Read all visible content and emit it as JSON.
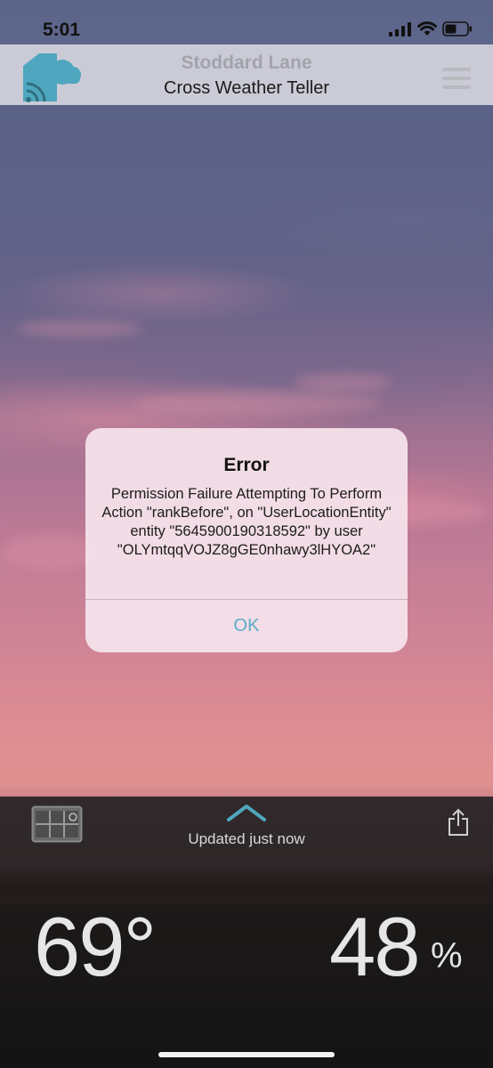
{
  "status_bar": {
    "time": "5:01"
  },
  "header": {
    "location": "Stoddard Lane",
    "app_name": "Cross Weather Teller",
    "logo_color": "#4fa6bf"
  },
  "dialog": {
    "title": "Error",
    "message": "Permission Failure Attempting To Perform Action \"rankBefore\", on \"UserLocationEntity\" entity \"5645900190318592\" by user \"OLYmtqqVOJZ8gGE0nhawy3lHYOA2\"",
    "ok_label": "OK",
    "ok_color": "#5aaecb"
  },
  "bottom": {
    "updated": "Updated just now",
    "temperature": "69°",
    "humidity_value": "48",
    "humidity_unit": "%",
    "accent_color": "#4fa6bf"
  }
}
